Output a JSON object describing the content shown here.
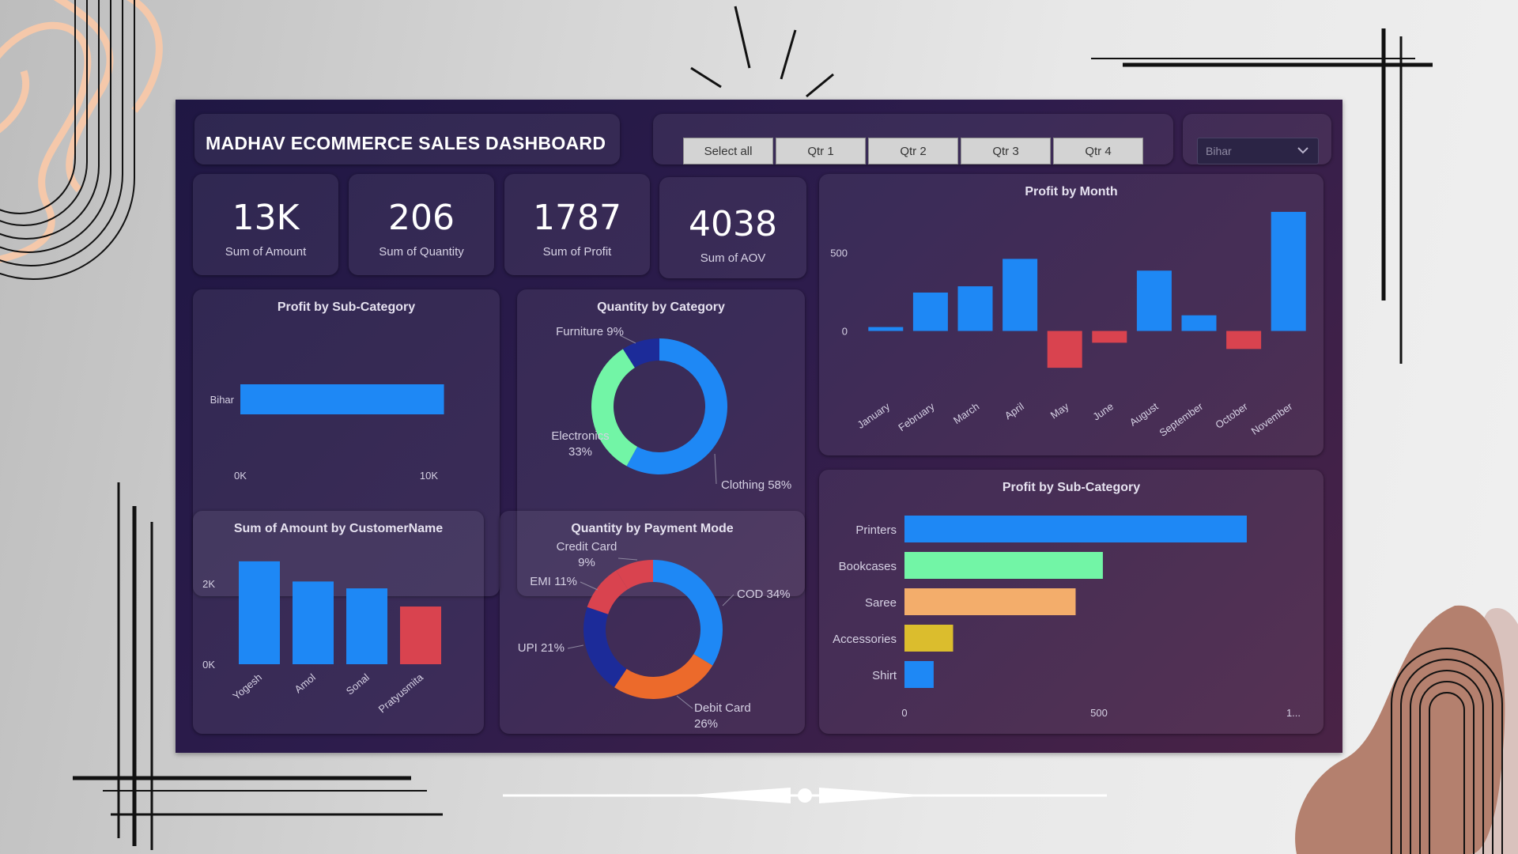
{
  "dashboard_title": "MADHAV ECOMMERCE SALES DASHBOARD",
  "quarter_slicer": {
    "buttons": [
      "Select all",
      "Qtr 1",
      "Qtr 2",
      "Qtr 3",
      "Qtr 4"
    ]
  },
  "state_dropdown": {
    "selected": "Bihar",
    "icon": "chevron-down-icon"
  },
  "kpis": [
    {
      "value": "13K",
      "label": "Sum of Amount"
    },
    {
      "value": "206",
      "label": "Sum of Quantity"
    },
    {
      "value": "1787",
      "label": "Sum of Profit"
    },
    {
      "value": "4038",
      "label": "Sum of AOV"
    }
  ],
  "colors": {
    "blue": "#1e88f5",
    "red": "#d9434f",
    "green": "#72f5a6",
    "navy": "#1c2b99",
    "orange": "#ec6a2b",
    "peach": "#f3ad6b",
    "yellow": "#dbbd2d"
  },
  "chart_data": [
    {
      "type": "bar",
      "title": "Profit by Sub-Category",
      "orientation": "horizontal",
      "categories": [
        "Bihar"
      ],
      "values": [
        10800
      ],
      "xlim": [
        0,
        13000
      ],
      "tick_labels": [
        "0K",
        "10K"
      ],
      "colors": [
        "#1e88f5"
      ]
    },
    {
      "type": "pie",
      "title": "Quantity by Category",
      "donut": true,
      "labels": [
        "Clothing",
        "Electronics",
        "Furniture"
      ],
      "values": [
        58,
        33,
        9
      ],
      "label_text": [
        "Clothing 58%",
        "Electronics\n33%",
        "Furniture 9%"
      ],
      "colors": [
        "#1e88f5",
        "#72f5a6",
        "#1c2b99"
      ]
    },
    {
      "type": "bar",
      "title": "Profit by Month",
      "categories": [
        "January",
        "February",
        "March",
        "April",
        "May",
        "June",
        "August",
        "September",
        "October",
        "November"
      ],
      "values": [
        25,
        245,
        285,
        460,
        -235,
        -75,
        385,
        100,
        -115,
        760
      ],
      "ylim": [
        -300,
        800
      ],
      "tick_labels": [
        "0",
        "500"
      ],
      "positive_color": "#1e88f5",
      "negative_color": "#d9434f"
    },
    {
      "type": "bar",
      "title": "Sum of Amount by CustomerName",
      "categories": [
        "Yogesh",
        "Amol",
        "Sonal",
        "Pratyusmita"
      ],
      "values": [
        2550,
        2050,
        1880,
        1430
      ],
      "ylim": [
        0,
        2900
      ],
      "tick_labels": [
        "0K",
        "2K"
      ],
      "colors": [
        "#1e88f5",
        "#1e88f5",
        "#1e88f5",
        "#d9434f"
      ]
    },
    {
      "type": "pie",
      "title": "Quantity by Payment Mode",
      "donut": true,
      "labels": [
        "COD",
        "Debit Card",
        "UPI",
        "EMI",
        "Credit Card"
      ],
      "values": [
        34,
        26,
        21,
        11,
        9
      ],
      "label_text": [
        "COD 34%",
        "Debit Card\n26%",
        "UPI 21%",
        "EMI 11%",
        "Credit Card\n9%"
      ],
      "colors": [
        "#1e88f5",
        "#ec6a2b",
        "#1c2b99",
        "#d9434f",
        "#d9434f"
      ]
    },
    {
      "type": "bar",
      "title": "Profit by Sub-Category",
      "orientation": "horizontal",
      "categories": [
        "Printers",
        "Bookcases",
        "Saree",
        "Accessories",
        "Shirt"
      ],
      "values": [
        880,
        510,
        440,
        125,
        75
      ],
      "xlim": [
        0,
        1000
      ],
      "tick_labels": [
        "0",
        "500",
        "1..."
      ],
      "colors": [
        "#1e88f5",
        "#72f5a6",
        "#f3ad6b",
        "#dbbd2d",
        "#1e88f5"
      ]
    }
  ]
}
